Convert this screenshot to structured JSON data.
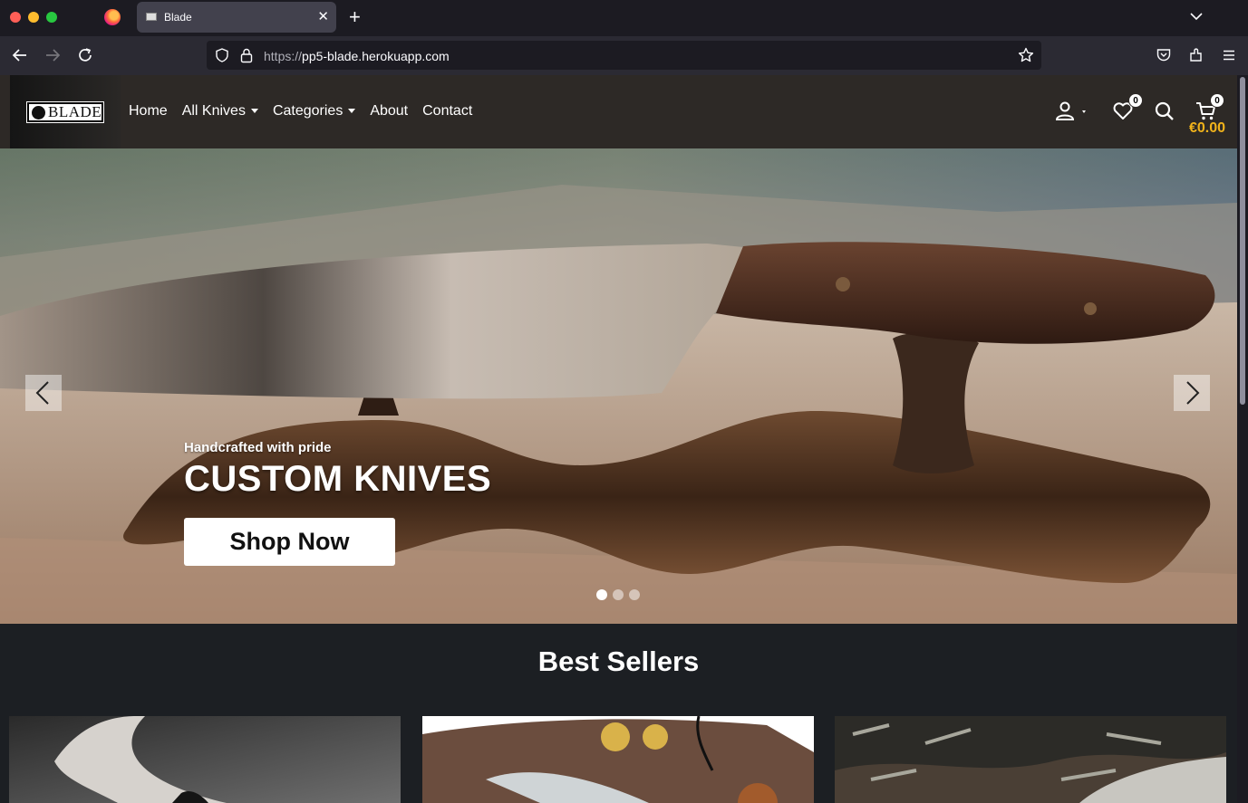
{
  "browser": {
    "tab_title": "Blade",
    "url_scheme": "https://",
    "url_host": "pp5-blade.herokuapp.com"
  },
  "site": {
    "logo_text": "BLADE",
    "nav": {
      "home": "Home",
      "all_knives": "All Knives",
      "categories": "Categories",
      "about": "About",
      "contact": "Contact"
    },
    "wishlist_count": "0",
    "cart_count": "0",
    "cart_total": "€0.00"
  },
  "hero": {
    "subtitle": "Handcrafted with pride",
    "title": "CUSTOM KNIVES",
    "button": "Shop Now",
    "slides": 3,
    "active_slide": 1
  },
  "best_sellers": {
    "title": "Best Sellers"
  },
  "colors": {
    "nav_bg": "#2d2926",
    "accent": "#f1b31b",
    "section_bg": "#1c1f23"
  }
}
